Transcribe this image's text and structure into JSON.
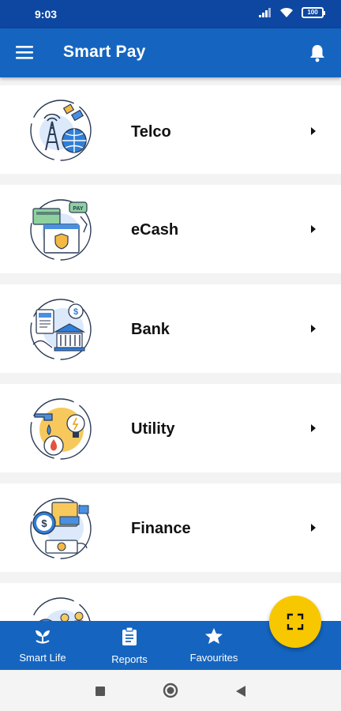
{
  "status_bar": {
    "time": "9:03",
    "battery": "100"
  },
  "app_bar": {
    "title": "Smart Pay"
  },
  "categories": [
    {
      "label": "Telco"
    },
    {
      "label": "eCash",
      "badge": "PAY"
    },
    {
      "label": "Bank"
    },
    {
      "label": "Utility"
    },
    {
      "label": "Finance"
    }
  ],
  "bottom_nav": {
    "items": [
      {
        "label": "Smart Life",
        "icon": "plant-icon"
      },
      {
        "label": "Reports",
        "icon": "clipboard-icon"
      },
      {
        "label": "Favourites",
        "icon": "star-icon"
      }
    ]
  },
  "fab": {
    "icon": "scan-icon"
  },
  "colors": {
    "primary": "#1565c0",
    "status_bar": "#0d47a1",
    "accent": "#f7c700"
  }
}
